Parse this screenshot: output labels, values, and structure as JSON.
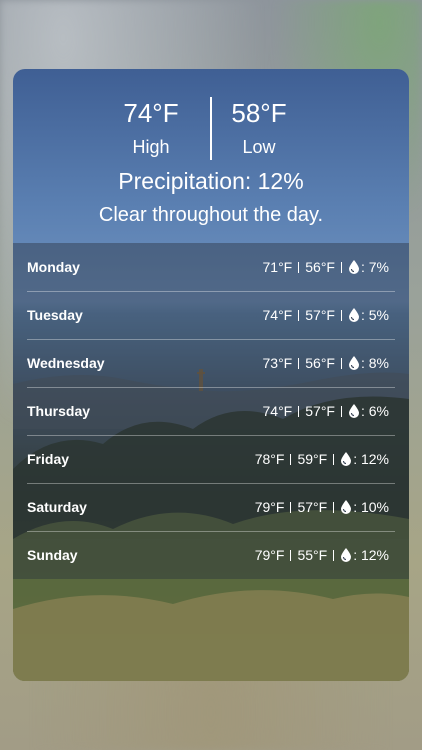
{
  "header": {
    "high_temp": "74°F",
    "high_label": "High",
    "low_temp": "58°F",
    "low_label": "Low",
    "precipitation": "Precipitation: 12%",
    "summary": "Clear throughout the day."
  },
  "days": [
    {
      "name": "Monday",
      "high": "71°F",
      "low": "56°F",
      "precip": ": 7%"
    },
    {
      "name": "Tuesday",
      "high": "74°F",
      "low": "57°F",
      "precip": ": 5%"
    },
    {
      "name": "Wednesday",
      "high": "73°F",
      "low": "56°F",
      "precip": ": 8%"
    },
    {
      "name": "Thursday",
      "high": "74°F",
      "low": "57°F",
      "precip": ": 6%"
    },
    {
      "name": "Friday",
      "high": "78°F",
      "low": "59°F",
      "precip": ": 12%"
    },
    {
      "name": "Saturday",
      "high": "79°F",
      "low": "57°F",
      "precip": ": 10%"
    },
    {
      "name": "Sunday",
      "high": "79°F",
      "low": "55°F",
      "precip": ": 12%"
    }
  ],
  "icons": {
    "precip_icon": "raindrop-icon"
  },
  "colors": {
    "text": "#ffffff",
    "sky_top": "#3f5f94",
    "sky_mid": "#6f93c0"
  }
}
